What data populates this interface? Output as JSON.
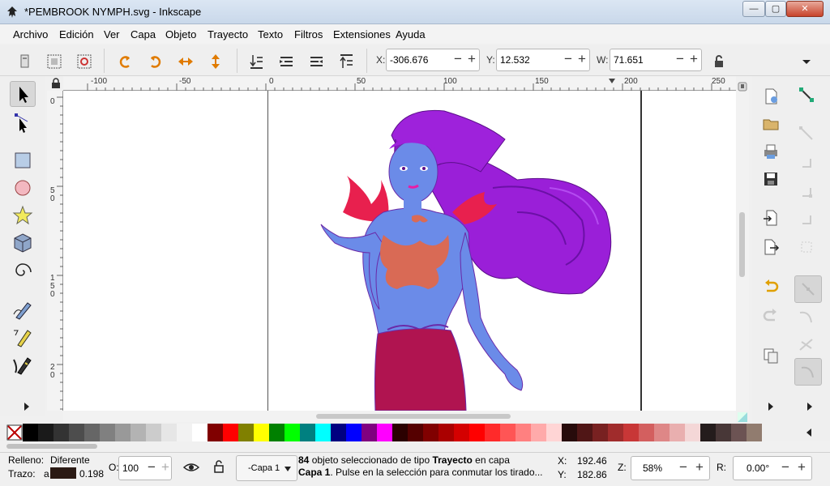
{
  "window": {
    "title": "*PEMBROOK NYMPH.svg - Inkscape",
    "minimize_glyph": "—",
    "maximize_glyph": "▢",
    "close_glyph": "✕"
  },
  "menu": [
    "Archivo",
    "Edición",
    "Ver",
    "Capa",
    "Objeto",
    "Trayecto",
    "Texto",
    "Filtros",
    "Extensiones",
    "Ayuda"
  ],
  "toolbar": {
    "x_label": "X:",
    "x_value": "-306.676",
    "y_label": "Y:",
    "y_value": "12.532",
    "w_label": "W:",
    "w_value": "71.651",
    "minus": "−",
    "plus": "+"
  },
  "rulers": {
    "top": [
      "-100",
      "-50",
      "0",
      "50",
      "100",
      "150",
      "200",
      "250"
    ],
    "left": [
      "0",
      "5",
      "0",
      "1",
      "5",
      "0",
      "2",
      "0"
    ]
  },
  "status": {
    "fill_label": "Relleno:",
    "fill_value": "Diferente",
    "stroke_label": "Trazo:",
    "stroke_prefix": "a",
    "stroke_width": "0.198",
    "stroke_color": "#2b1a14",
    "opacity_label": "O:",
    "opacity_value": "100",
    "layer_name": "-Capa 1",
    "msg_count": "84",
    "msg_part1": " objeto seleccionado de tipo ",
    "msg_type": "Trayecto",
    "msg_part2": " en capa",
    "msg_layer": "Capa 1",
    "msg_part3": ". Pulse en la selección para conmutar los tirado...",
    "cursor_x_label": "X:",
    "cursor_x": "192.46",
    "cursor_y_label": "Y:",
    "cursor_y": "182.86",
    "zoom_label": "Z:",
    "zoom": "58%",
    "rotation_label": "R:",
    "rotation": "0.00°"
  },
  "palette": [
    "#000000",
    "#1a1a1a",
    "#333333",
    "#4d4d4d",
    "#666666",
    "#808080",
    "#999999",
    "#b3b3b3",
    "#cccccc",
    "#e6e6e6",
    "#f2f2f2",
    "#ffffff",
    "#800000",
    "#ff0000",
    "#808000",
    "#ffff00",
    "#008000",
    "#00ff00",
    "#008080",
    "#00ffff",
    "#000080",
    "#0000ff",
    "#800080",
    "#ff00ff",
    "#2b0000",
    "#550000",
    "#800000",
    "#aa0000",
    "#d40000",
    "#ff0000",
    "#ff2a2a",
    "#ff5555",
    "#ff8080",
    "#ffaaaa",
    "#ffd5d5",
    "#280b0b",
    "#501616",
    "#782121",
    "#a02c2c",
    "#c83737",
    "#d35f5f",
    "#de8787",
    "#e9afaf",
    "#f4d7d7",
    "#241c1c",
    "#483737",
    "#6c5353",
    "#917c6f"
  ]
}
